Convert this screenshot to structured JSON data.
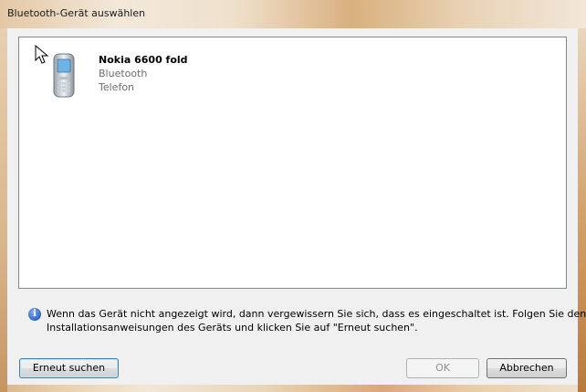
{
  "window": {
    "title": "Bluetooth-Gerät auswählen"
  },
  "devices": [
    {
      "name": "Nokia 6600 fold",
      "type": "Bluetooth",
      "category": "Telefon",
      "icon": "mobile-phone-icon"
    }
  ],
  "info": {
    "icon": "info-icon",
    "line1": "Wenn das Gerät nicht angezeigt wird, dann vergewissern Sie sich, dass es eingeschaltet ist. Folgen Sie den",
    "line2": "Installationsanweisungen des Geräts und klicken Sie auf \"Erneut suchen\"."
  },
  "buttons": {
    "search_again": "Erneut suchen",
    "ok": "OK",
    "cancel": "Abbrechen"
  }
}
